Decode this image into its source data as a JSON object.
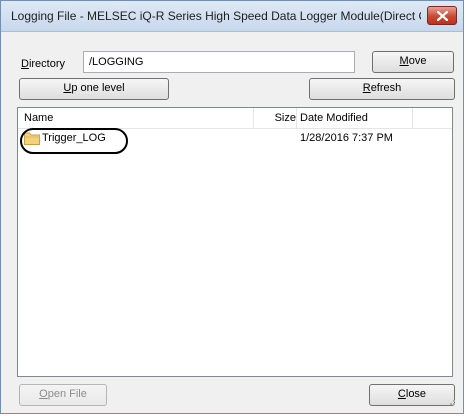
{
  "window": {
    "title": "Logging File - MELSEC iQ-R Series High Speed Data Logger Module(Direct Conne..."
  },
  "directory": {
    "label_first": "D",
    "label_rest": "irectory",
    "value": "/LOGGING"
  },
  "buttons": {
    "move_first": "M",
    "move_rest": "ove",
    "up_first": "U",
    "up_rest": "p one level",
    "refresh_first": "R",
    "refresh_rest": "efresh",
    "open_first": "O",
    "open_rest": "pen File",
    "close_first": "C",
    "close_rest": "lose"
  },
  "list": {
    "columns": {
      "name": "Name",
      "size": "Size",
      "date": "Date Modified"
    },
    "rows": [
      {
        "name": "Trigger_LOG",
        "size": "",
        "date": "1/28/2016 7:37 PM",
        "icon": "folder-icon"
      }
    ]
  },
  "colors": {
    "title_bar": "#c7d8ec",
    "close_button": "#c74a35",
    "folder": "#f2d27a"
  }
}
